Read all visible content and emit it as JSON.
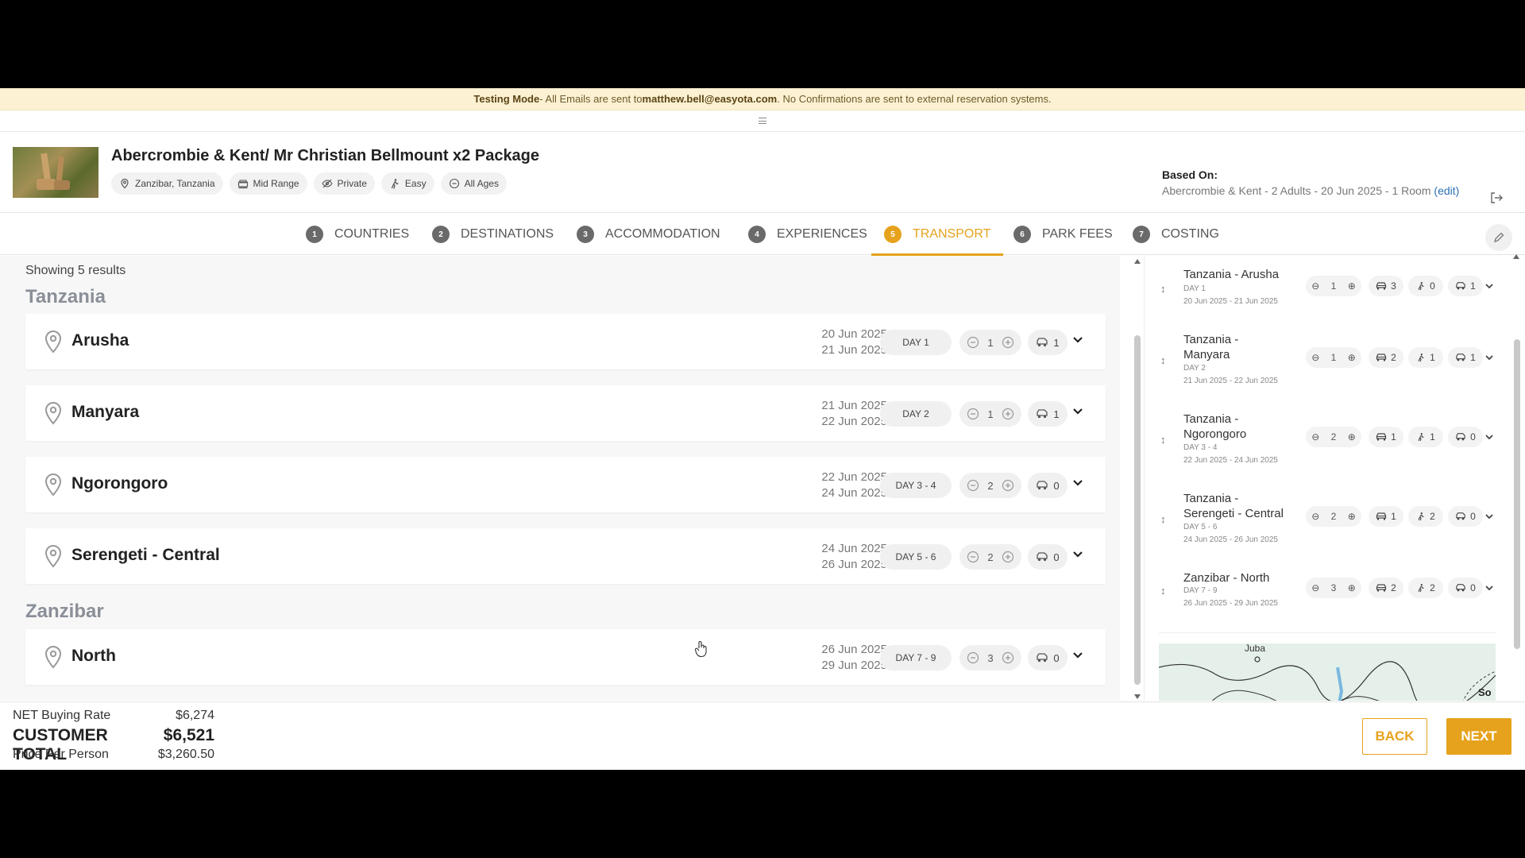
{
  "banner": {
    "mode": "Testing Mode",
    "part1": " - All Emails are sent to ",
    "email": "matthew.bell@easyota.com",
    "part2": ". No Confirmations are sent to external reservation systems."
  },
  "package": {
    "title": "Abercrombie & Kent/ Mr Christian Bellmount x2 Package",
    "chips": [
      "Zanzibar, Tanzania",
      "Mid Range",
      "Private",
      "Easy",
      "All Ages"
    ]
  },
  "based_on": {
    "label": "Based On:",
    "value": "Abercrombie & Kent - 2 Adults - 20 Jun 2025 - 1 Room",
    "edit": "(edit)"
  },
  "tabs": [
    {
      "num": "1",
      "label": "COUNTRIES"
    },
    {
      "num": "2",
      "label": "DESTINATIONS"
    },
    {
      "num": "3",
      "label": "ACCOMMODATION"
    },
    {
      "num": "4",
      "label": "EXPERIENCES"
    },
    {
      "num": "5",
      "label": "TRANSPORT"
    },
    {
      "num": "6",
      "label": "PARK FEES"
    },
    {
      "num": "7",
      "label": "COSTING"
    }
  ],
  "results": {
    "showing": "Showing 5 results",
    "countries": [
      "Tanzania",
      "Zanzibar"
    ],
    "destinations": [
      {
        "name": "Arusha",
        "start": "20 Jun 2025",
        "end": "21 Jun 2025",
        "day": "DAY 1",
        "nights": "1",
        "vehicles": "1"
      },
      {
        "name": "Manyara",
        "start": "21 Jun 2025",
        "end": "22 Jun 2025",
        "day": "DAY 2",
        "nights": "1",
        "vehicles": "1"
      },
      {
        "name": "Ngorongoro",
        "start": "22 Jun 2025",
        "end": "24 Jun 2025",
        "day": "DAY 3 - 4",
        "nights": "2",
        "vehicles": "0"
      },
      {
        "name": "Serengeti - Central",
        "start": "24 Jun 2025",
        "end": "26 Jun 2025",
        "day": "DAY 5 - 6",
        "nights": "2",
        "vehicles": "0"
      },
      {
        "name": "North",
        "start": "26 Jun 2025",
        "end": "29 Jun 2025",
        "day": "DAY 7 - 9",
        "nights": "3",
        "vehicles": "0"
      }
    ]
  },
  "itinerary": [
    {
      "name": "Tanzania - Arusha",
      "day": "DAY 1",
      "dates": "20 Jun 2025 - 21 Jun 2025",
      "nights": "1",
      "cars": "3",
      "transfers": "0",
      "vehicles": "1"
    },
    {
      "name": "Tanzania - Manyara",
      "day": "DAY 2",
      "dates": "21 Jun 2025 - 22 Jun 2025",
      "nights": "1",
      "cars": "2",
      "transfers": "1",
      "vehicles": "1"
    },
    {
      "name": "Tanzania - Ngorongoro",
      "day": "DAY 3 - 4",
      "dates": "22 Jun 2025 - 24 Jun 2025",
      "nights": "2",
      "cars": "1",
      "transfers": "1",
      "vehicles": "0"
    },
    {
      "name": "Tanzania - Serengeti - Central",
      "day": "DAY 5 - 6",
      "dates": "24 Jun 2025 - 26 Jun 2025",
      "nights": "2",
      "cars": "1",
      "transfers": "2",
      "vehicles": "0"
    },
    {
      "name": "Zanzibar - North",
      "day": "DAY 7 - 9",
      "dates": "26 Jun 2025 - 29 Jun 2025",
      "nights": "3",
      "cars": "2",
      "transfers": "2",
      "vehicles": "0"
    }
  ],
  "map": {
    "label_juba": "Juba",
    "label_so": "So"
  },
  "footer": {
    "net_label": "NET Buying Rate",
    "net_value": "$6,274",
    "total_label": "CUSTOMER TOTAL",
    "total_value": "$6,521",
    "ppp_label": "Price Per Person",
    "ppp_value": "$3,260.50",
    "back": "BACK",
    "next": "NEXT"
  },
  "colors": {
    "accent": "#e6a21c",
    "banner_bg": "#fdf1d3",
    "panel_bg": "#f7f7f7"
  }
}
